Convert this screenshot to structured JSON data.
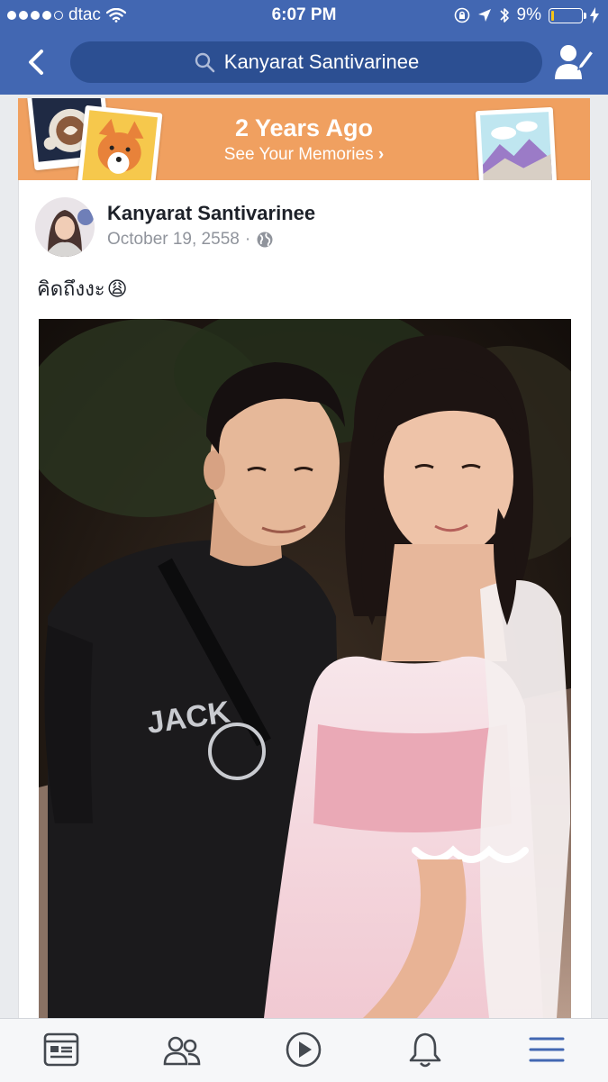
{
  "status_bar": {
    "carrier": "dtac",
    "time": "6:07 PM",
    "battery_percent": "9%",
    "battery_level": 0.09,
    "signal_bars_filled": 4
  },
  "nav": {
    "search_text": "Kanyarat Santivarinee"
  },
  "memories": {
    "title": "2 Years Ago",
    "subtitle": "See Your Memories"
  },
  "post": {
    "author": "Kanyarat Santivarinee",
    "date": "October 19, 2558",
    "separator": "·",
    "privacy_icon": "globe-icon",
    "text": "คิดถึงงะ",
    "emoji": "😩"
  },
  "tabs": [
    {
      "icon": "news-feed-icon",
      "active": false
    },
    {
      "icon": "friends-icon",
      "active": false
    },
    {
      "icon": "video-icon",
      "active": false
    },
    {
      "icon": "notifications-bell-icon",
      "active": false
    },
    {
      "icon": "menu-icon",
      "active": true
    }
  ],
  "colors": {
    "brand_blue": "#4267b2",
    "search_bg": "#2c4f92",
    "banner_orange": "#f0a060",
    "active_tab": "#4267b2",
    "inactive_tab": "#444950"
  }
}
